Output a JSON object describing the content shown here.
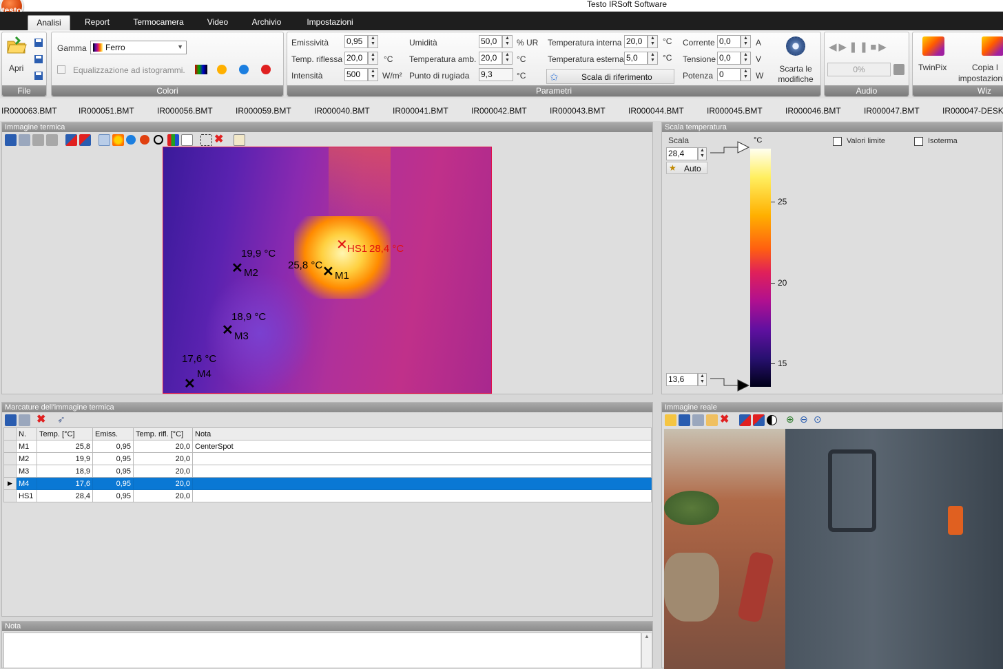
{
  "app": {
    "title": "Testo IRSoft Software",
    "logo": "testo"
  },
  "tabs": [
    {
      "label": "Analisi",
      "active": true
    },
    {
      "label": "Report"
    },
    {
      "label": "Termocamera"
    },
    {
      "label": "Video"
    },
    {
      "label": "Archivio"
    },
    {
      "label": "Impostazioni"
    }
  ],
  "ribbon": {
    "file": {
      "caption": "File",
      "open_label": "Apri"
    },
    "colors": {
      "caption": "Colori",
      "gamma_label": "Gamma",
      "gamma_value": "Ferro",
      "equalize_label": "Equalizzazione ad istogrammi."
    },
    "params": {
      "caption": "Parametri",
      "emissivity_label": "Emissività",
      "emissivity_value": "0,95",
      "refl_temp_label": "Temp. riflessa",
      "refl_temp_value": "20,0",
      "refl_temp_unit": "°C",
      "intensity_label": "Intensità",
      "intensity_value": "500",
      "intensity_unit": "W/m²",
      "humidity_label": "Umidità",
      "humidity_value": "50,0",
      "humidity_unit": "% UR",
      "amb_temp_label": "Temperatura amb.",
      "amb_temp_value": "20,0",
      "amb_temp_unit": "°C",
      "dew_label": "Punto di rugiada",
      "dew_value": "9,3",
      "dew_unit": "°C",
      "int_temp_label": "Temperatura interna",
      "int_temp_value": "20,0",
      "int_temp_unit": "°C",
      "ext_temp_label": "Temperatura esterna",
      "ext_temp_value": "5,0",
      "ext_temp_unit": "°C",
      "ref_scale_label": "Scala di riferimento",
      "current_label": "Corrente",
      "current_value": "0,0",
      "current_unit": "A",
      "voltage_label": "Tensione",
      "voltage_value": "0,0",
      "voltage_unit": "V",
      "power_label": "Potenza",
      "power_value": "0",
      "power_unit": "W",
      "discard_label_1": "Scarta le",
      "discard_label_2": "modifiche"
    },
    "audio": {
      "caption": "Audio",
      "progress": "0%"
    },
    "wizard": {
      "caption": "Wiz",
      "twinpix_label": "TwinPix",
      "copy_label_1": "Copia I",
      "copy_label_2": "impostazioni"
    }
  },
  "files": [
    "IR000063.BMT",
    "IR000051.BMT",
    "IR000056.BMT",
    "IR000059.BMT",
    "IR000040.BMT",
    "IR000041.BMT",
    "IR000042.BMT",
    "IR000043.BMT",
    "IR000044.BMT",
    "IR000045.BMT",
    "IR000046.BMT",
    "IR000047.BMT",
    "IR000047-DESKT"
  ],
  "thermal": {
    "title": "Immagine termica",
    "markers": [
      {
        "name": "M1",
        "temp": "25,8 °C"
      },
      {
        "name": "M2",
        "temp": "19,9 °C"
      },
      {
        "name": "M3",
        "temp": "18,9 °C"
      },
      {
        "name": "M4",
        "temp": "17,6 °C"
      },
      {
        "name": "HS1",
        "temp": "28,4 °C"
      }
    ]
  },
  "scale": {
    "title": "Scala temperatura",
    "scale_label": "Scala",
    "max_value": "28,4",
    "min_value": "13,6",
    "auto_label": "Auto",
    "unit": "°C",
    "ticks": [
      "25",
      "20",
      "15"
    ],
    "limits_label": "Valori limite",
    "isotherm_label": "Isoterma"
  },
  "markings": {
    "title": "Marcature dell'immagine termica",
    "columns": [
      "N.",
      "Temp. [°C]",
      "Emiss.",
      "Temp. rifl. [°C]",
      "Nota"
    ],
    "rows": [
      {
        "n": "M1",
        "temp": "25,8",
        "emiss": "0,95",
        "refl": "20,0",
        "note": "CenterSpot"
      },
      {
        "n": "M2",
        "temp": "19,9",
        "emiss": "0,95",
        "refl": "20,0",
        "note": ""
      },
      {
        "n": "M3",
        "temp": "18,9",
        "emiss": "0,95",
        "refl": "20,0",
        "note": ""
      },
      {
        "n": "M4",
        "temp": "17,6",
        "emiss": "0,95",
        "refl": "20,0",
        "note": ""
      },
      {
        "n": "HS1",
        "temp": "28,4",
        "emiss": "0,95",
        "refl": "20,0",
        "note": ""
      }
    ],
    "selected_row": 3
  },
  "note": {
    "title": "Nota"
  },
  "real": {
    "title": "Immagine reale"
  }
}
